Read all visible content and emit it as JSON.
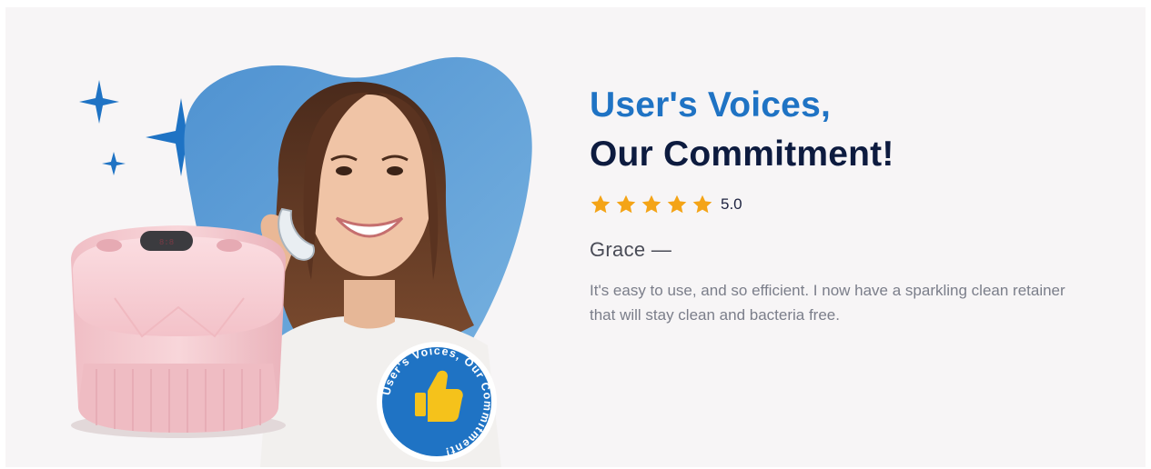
{
  "section": {
    "title_line1": "User's Voices,",
    "title_line2": "Our Commitment!",
    "rating_value": "5.0",
    "star_count": 5,
    "author": "Grace —",
    "quote": "It's easy to use, and so efficient. I now have a sparkling clean retainer that will stay clean and bacteria free."
  },
  "badge": {
    "ring_text": "User's Voices, Our Commitment!"
  },
  "colors": {
    "accent_blue": "#1f73c4",
    "navy": "#0d1b3f",
    "star_gold": "#f4a417",
    "tooth_blue": "#5e9fd6",
    "product_pink": "#f4c9cf",
    "background": "#f7f5f6"
  },
  "icons": {
    "sparkle": "sparkle-icon",
    "star": "star-icon",
    "thumbs_up": "thumbs-up-icon"
  }
}
